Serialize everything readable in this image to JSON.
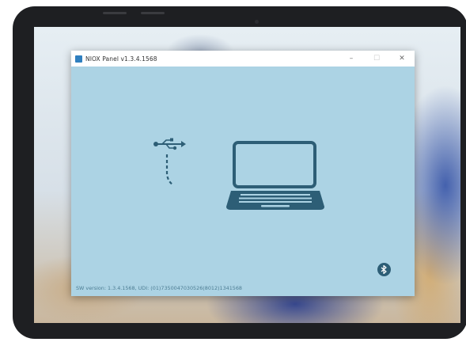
{
  "window": {
    "title": "NIOX Panel v1.3.4.1568",
    "controls": {
      "minimize": "–",
      "maximize": "☐",
      "close": "✕"
    }
  },
  "main": {
    "usb_icon": "usb-icon",
    "laptop_icon": "laptop-icon",
    "bluetooth_icon": "bluetooth-icon"
  },
  "footer": {
    "sw_version": "SW version: 1.3.4.1568, UDI: (01)7350047030526(8012)1341568"
  },
  "colors": {
    "window_background": "#acd3e4",
    "icon_color": "#2d5e76",
    "titlebar": "#ffffff"
  }
}
